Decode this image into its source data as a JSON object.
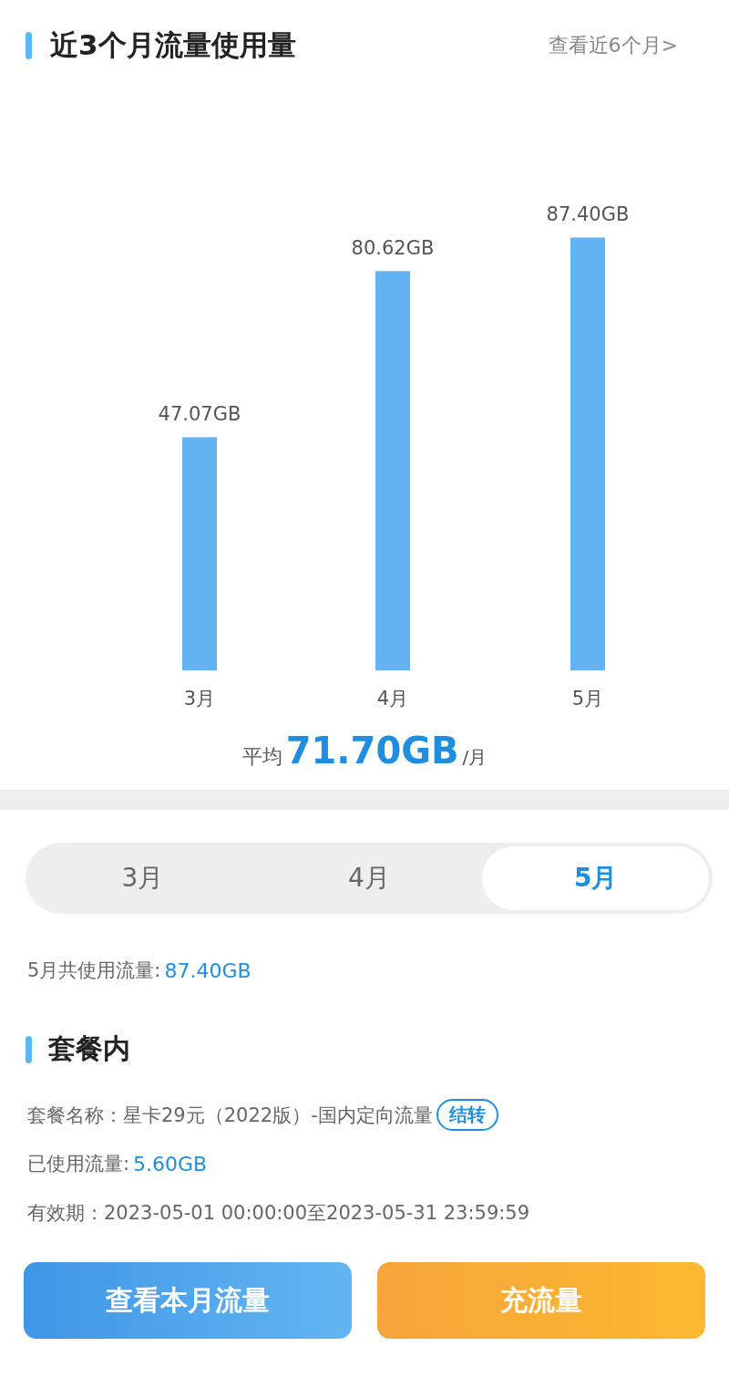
{
  "header": {
    "title": "近3个月流量使用量",
    "link": "查看近6个月>"
  },
  "usage_chart": {
    "chart_data": {
      "type": "bar",
      "categories": [
        "3月",
        "4月",
        "5月"
      ],
      "values": [
        47.07,
        80.62,
        87.4
      ],
      "value_labels": [
        "47.07GB",
        "80.62GB",
        "87.40GB"
      ],
      "data_labels": true
    }
  },
  "average": {
    "label": "平均",
    "value": "71.70GB",
    "unit": "/月"
  },
  "month_tabs": [
    {
      "label": "3月",
      "selected": false
    },
    {
      "label": "4月",
      "selected": false
    },
    {
      "label": "5月",
      "selected": true
    }
  ],
  "month_total": {
    "label": "5月共使用流量:",
    "value": "87.40GB"
  },
  "package_section": {
    "title": "套餐内",
    "name_label": "套餐名称：星卡29元（2022版）-国内定向流量",
    "name_tag": "结转",
    "used_label": "已使用流量:",
    "used_value": "5.60GB",
    "validity": "有效期：2023-05-01 00:00:00至2023-05-31 23:59:59"
  },
  "buttons": [
    {
      "label": "查看本月流量",
      "kind": "primary"
    },
    {
      "label": "充流量",
      "kind": "secondary"
    }
  ]
}
